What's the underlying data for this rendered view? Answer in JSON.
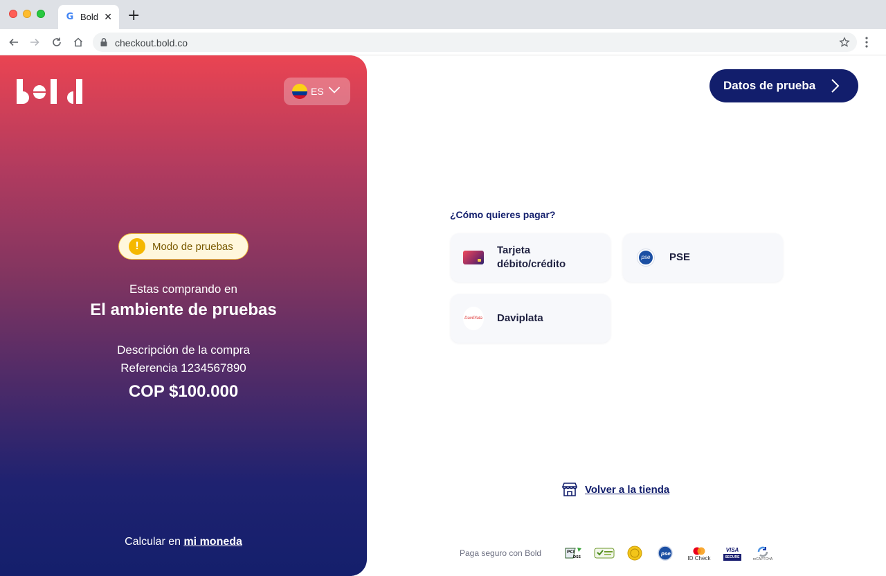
{
  "browser": {
    "tab_title": "Bold",
    "tab_close": "✕",
    "new_tab": "+",
    "url": "checkout.bold.co"
  },
  "left_panel": {
    "logo_text": "bold",
    "language": {
      "code": "ES",
      "flag": "colombia-flag-icon"
    },
    "badge": {
      "icon": "!",
      "text": "Modo de pruebas"
    },
    "buying_in": "Estas comprando en",
    "store_name": "El ambiente de pruebas",
    "description": "Descripción de la compra",
    "reference": "Referencia 1234567890",
    "amount": "COP $100.000",
    "calc_prefix": "Calcular en ",
    "calc_link": "mi moneda"
  },
  "right_panel": {
    "test_data_button": "Datos de prueba",
    "question": "¿Cómo quieres pagar?",
    "methods": [
      {
        "label_line1": "Tarjeta",
        "label_line2": "débito/crédito",
        "icon": "card-icon"
      },
      {
        "label": "PSE",
        "icon": "pse-icon"
      },
      {
        "label": "Daviplata",
        "icon": "daviplata-icon"
      }
    ],
    "back_to_store": "Volver a la tienda",
    "secure_text": "Paga seguro con Bold",
    "badges": {
      "pci": "PCI DSS",
      "pse": "pse",
      "mastercard": "ID Check",
      "visa": "VISA",
      "visa_secure": "SECURE",
      "recaptcha": "reCAPTCHA"
    }
  },
  "colors": {
    "primary": "#121e6c",
    "gradient_top": "#ea4452",
    "gradient_bottom": "#141f6c",
    "badge_bg": "#fff7dc"
  }
}
